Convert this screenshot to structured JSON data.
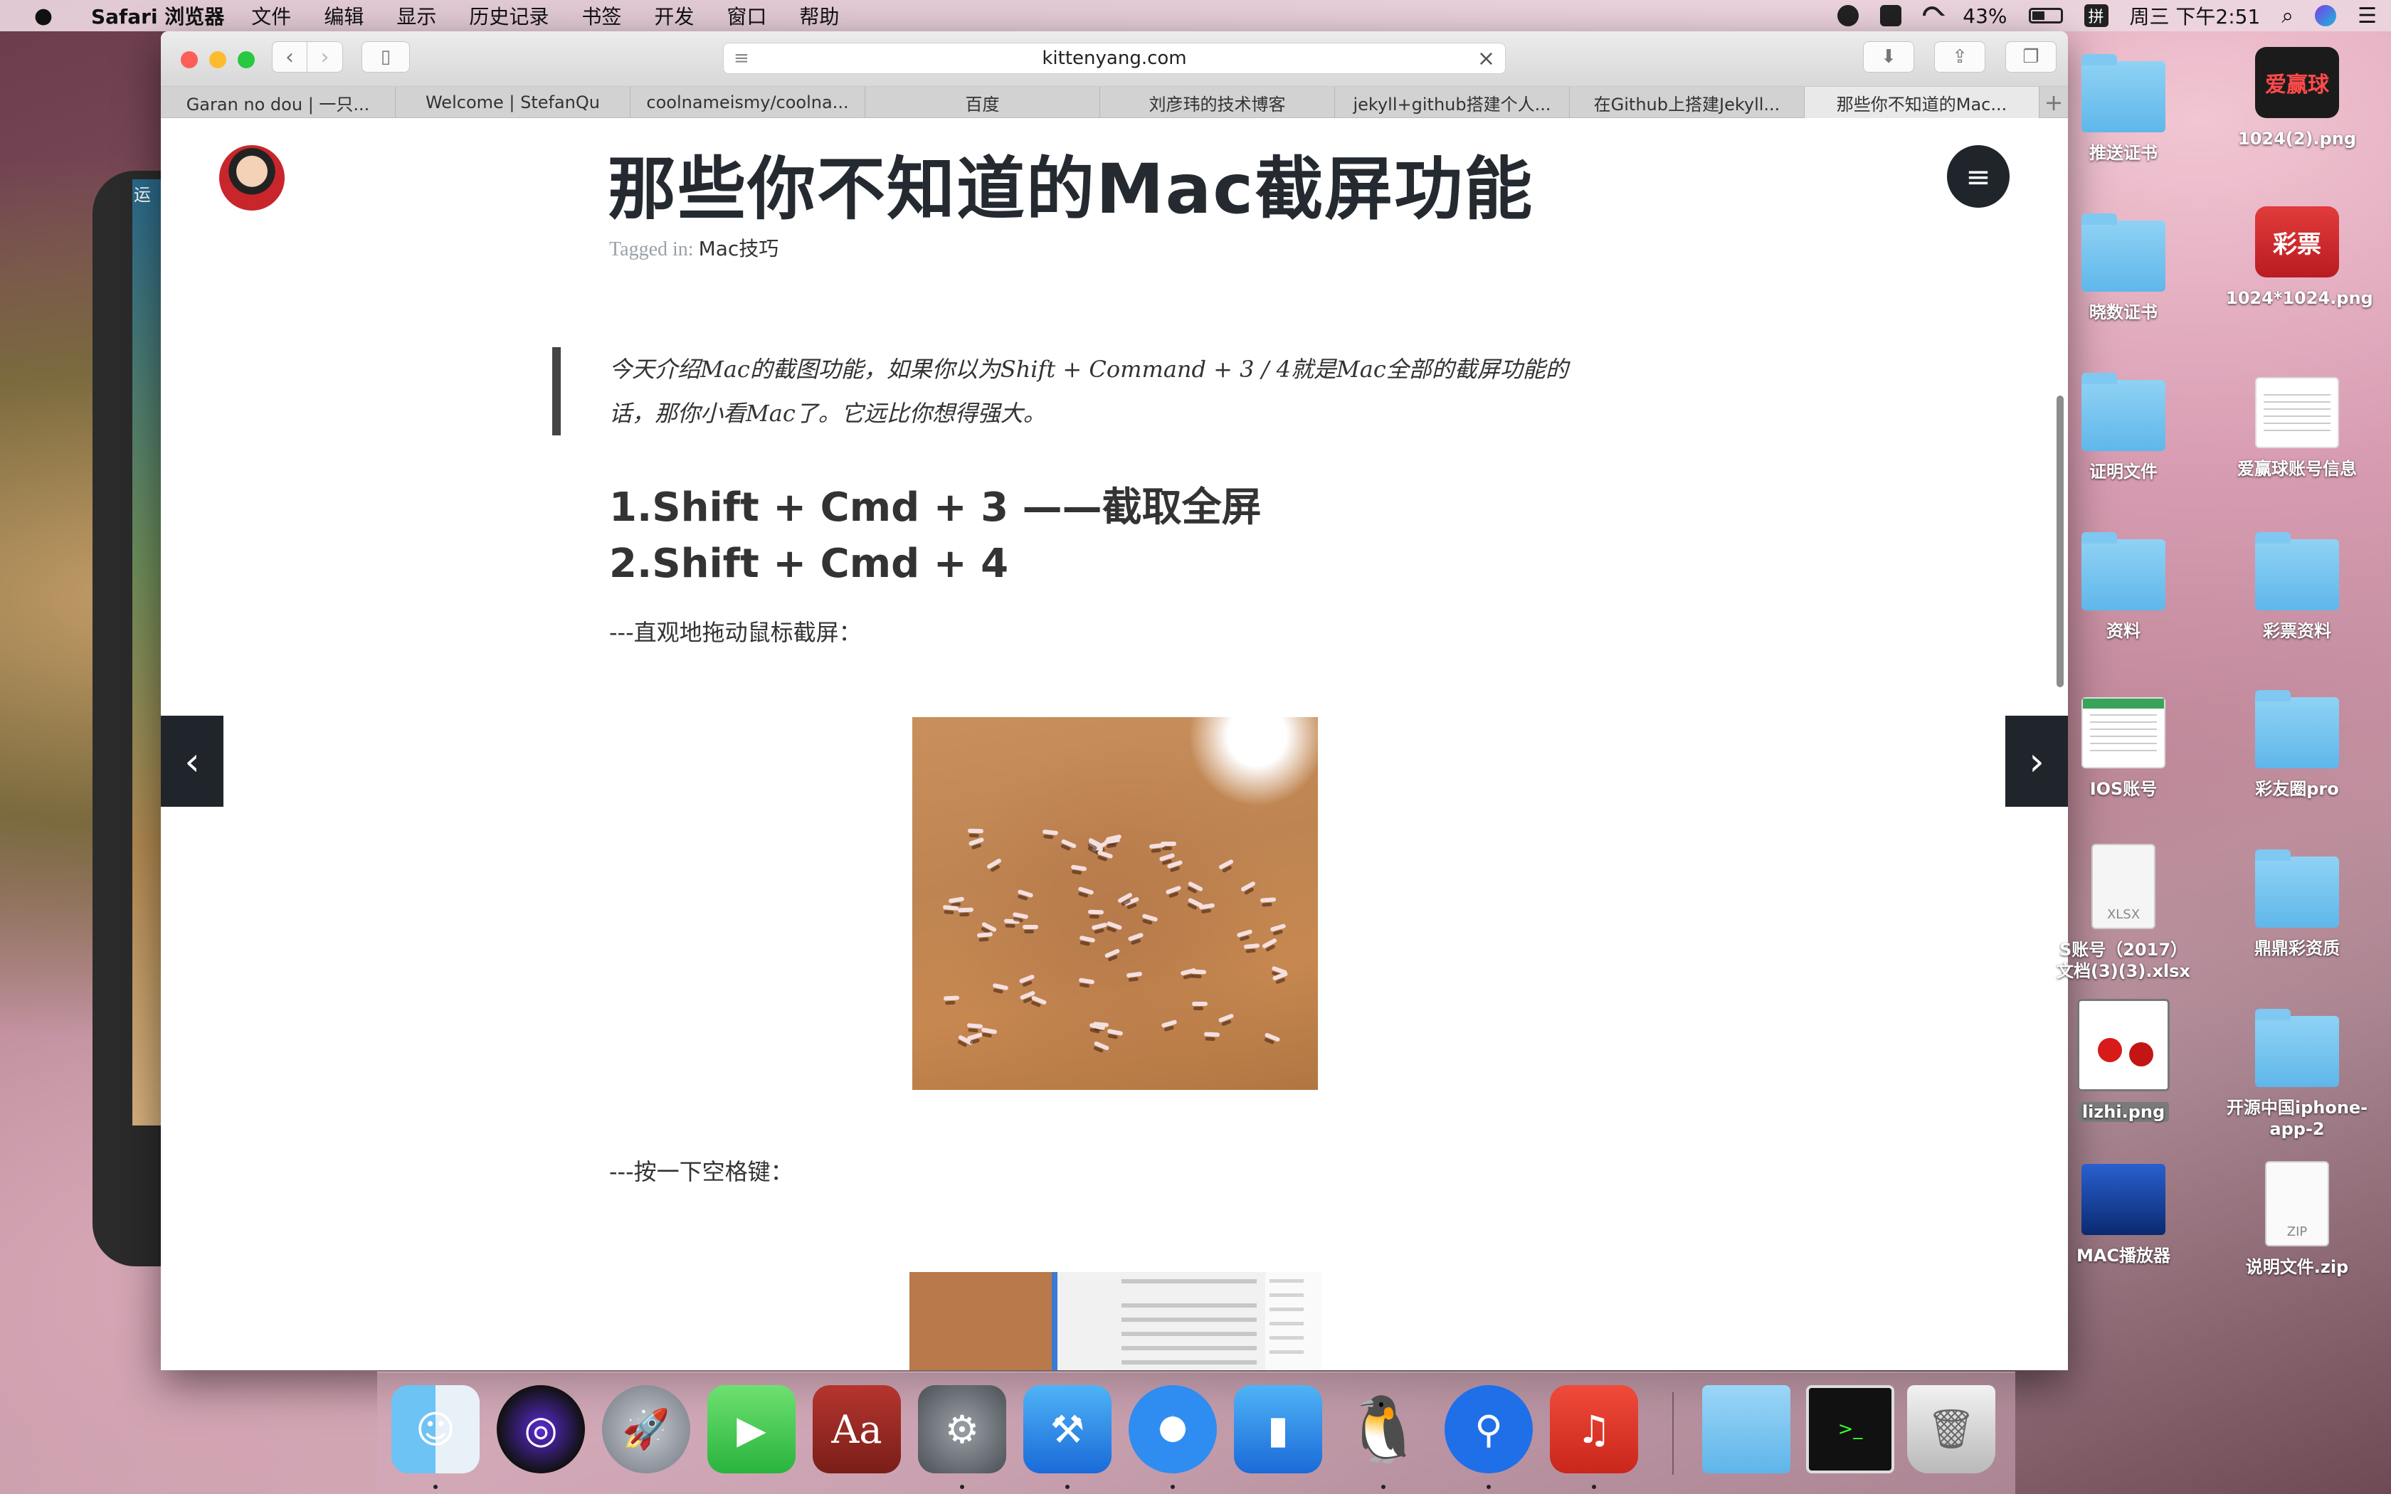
{
  "menubar": {
    "apple": "",
    "app_name": "Safari 浏览器",
    "items": [
      "文件",
      "编辑",
      "显示",
      "历史记录",
      "书签",
      "开发",
      "窗口",
      "帮助"
    ],
    "battery": "43%",
    "battery_level": 0.43,
    "ime": "拼",
    "clock": "周三 下午2:51"
  },
  "background_window": {
    "label": "运"
  },
  "safari": {
    "address": "kittenyang.com",
    "tabs": [
      "Garan no dou | 一只...",
      "Welcome | StefanQu",
      "coolnameismy/coolna...",
      "百度",
      "刘彦玮的技术博客",
      "jekyll+github搭建个人...",
      "在Github上搭建Jekyll...",
      "那些你不知道的Mac..."
    ],
    "active_tab": 7
  },
  "page": {
    "title": "那些你不知道的Mac截屏功能",
    "tagged_prefix": "Tagged in:",
    "tag": "Mac技巧",
    "quote": "今天介绍Mac的截图功能，如果你以为Shift + Command + 3 / 4就是Mac全部的截屏功能的话，那你小看Mac了。它远比你想得强大。",
    "heading1": "1.Shift + Cmd + 3 ——截取全屏",
    "heading2": "2.Shift + Cmd + 4",
    "para_drag": "---直观地拖动鼠标截屏：",
    "para_space": "---按一下空格键："
  },
  "desktop": {
    "icons": [
      {
        "label": "推送证书",
        "type": "folder"
      },
      {
        "label": "1024(2).png",
        "type": "app-dark",
        "glyph": "爱赢球"
      },
      {
        "label": "晓数证书",
        "type": "folder"
      },
      {
        "label": "1024*1024.png",
        "type": "app-red",
        "glyph": "彩票"
      },
      {
        "label": "证明文件",
        "type": "folder"
      },
      {
        "label": "爱赢球账号信息",
        "type": "sheet"
      },
      {
        "label": "资料",
        "type": "folder"
      },
      {
        "label": "彩票资料",
        "type": "folder"
      },
      {
        "label": "IOS账号",
        "type": "sheet"
      },
      {
        "label": "彩友圈pro",
        "type": "folder"
      },
      {
        "label": "S账号（2017）",
        "label2": "文档(3)(3).xlsx",
        "type": "xlsx",
        "glyph": "XLSX"
      },
      {
        "label": "鼎鼎彩资质",
        "type": "folder"
      },
      {
        "label": "lizhi.png",
        "type": "cherry"
      },
      {
        "label": "开源中国iphone-",
        "label2": "app-2",
        "type": "folder"
      },
      {
        "label": "MAC播放器",
        "type": "clapper"
      },
      {
        "label": "说明文件.zip",
        "type": "zip",
        "glyph": "ZIP"
      }
    ]
  },
  "dock": {
    "items": [
      "finder-icon",
      "siri-icon",
      "launchpad-icon",
      "facetime-icon",
      "dictionary-icon",
      "system-preferences-icon",
      "xcode-icon",
      "safari-icon",
      "simulator-icon",
      "qq-icon",
      "pin-app-icon",
      "netease-music-icon"
    ],
    "right_items": [
      "downloads-folder-icon",
      "terminal-icon",
      "trash-icon"
    ]
  },
  "colors": {
    "accent_dark": "#1f252b",
    "close": "#fc5f57",
    "minimize": "#fdbb2e",
    "maximize": "#28c840"
  }
}
